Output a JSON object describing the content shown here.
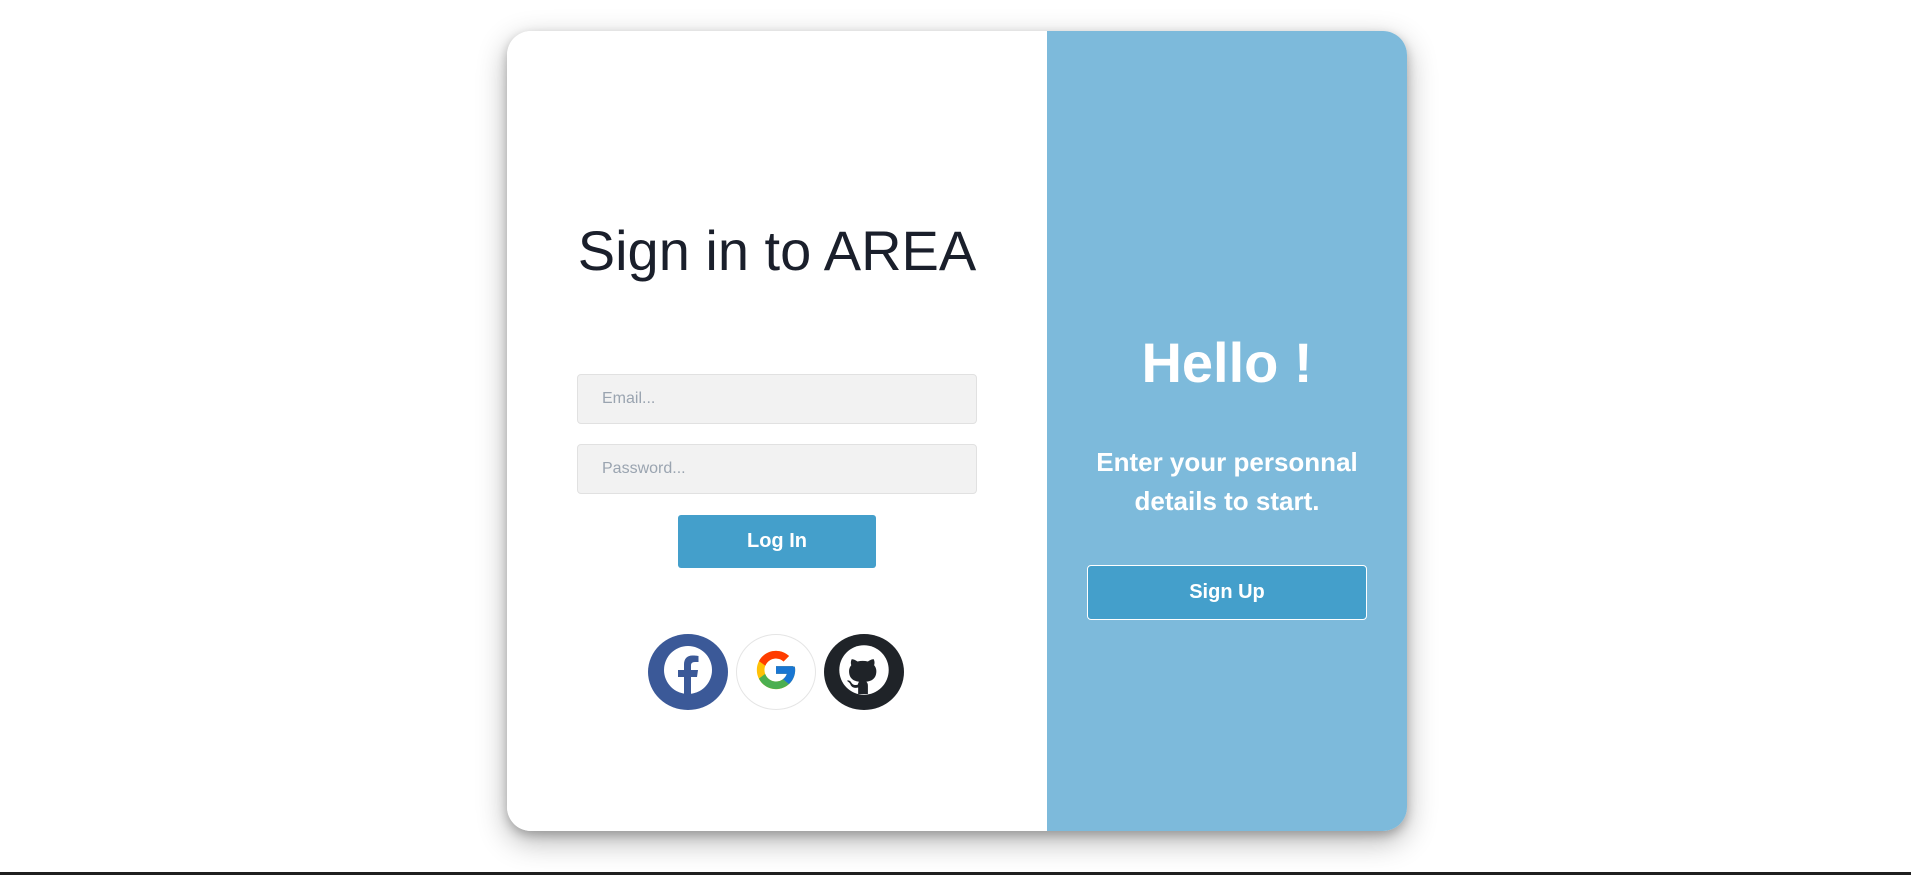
{
  "signin": {
    "title": "Sign in to AREA",
    "email_placeholder": "Email...",
    "password_placeholder": "Password...",
    "login_label": "Log In",
    "social": [
      {
        "name": "facebook-icon",
        "color": "#3b5998"
      },
      {
        "name": "google-icon",
        "color": "#ffffff"
      },
      {
        "name": "github-icon",
        "color": "#1f2328"
      }
    ]
  },
  "panel": {
    "title": "Hello !",
    "subtitle": "Enter your personnal details to start.",
    "signup_label": "Sign Up",
    "background": "#7dbadb"
  },
  "colors": {
    "accent": "#449fcb",
    "heading": "#1a1f2b"
  }
}
